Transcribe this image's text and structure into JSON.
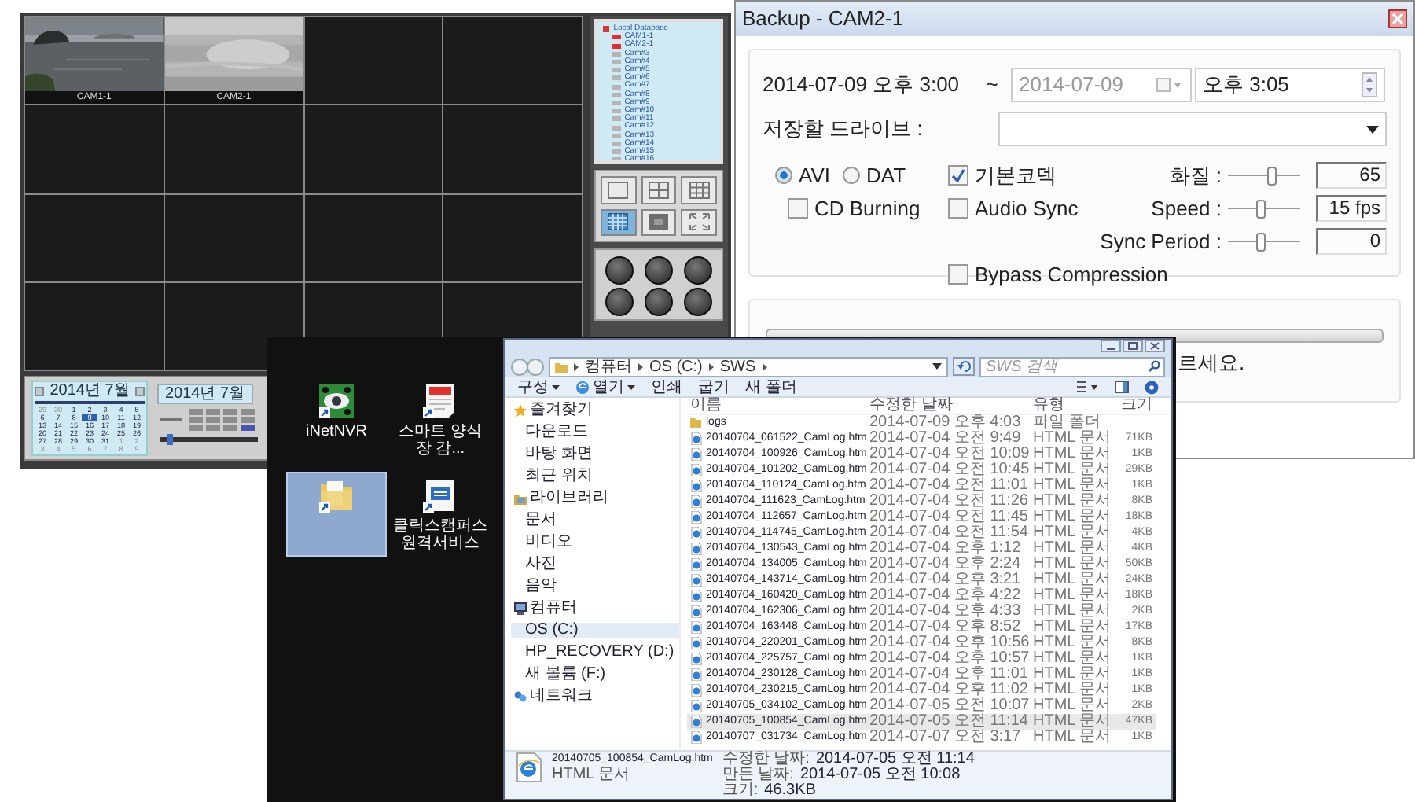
{
  "dvr": {
    "tiles": [
      {
        "kind": "picture",
        "label": "CAM1-1"
      },
      {
        "kind": "picture",
        "label": "CAM2-1"
      },
      {
        "kind": "empty"
      },
      {
        "kind": "empty"
      },
      {
        "kind": "empty"
      },
      {
        "kind": "empty"
      },
      {
        "kind": "empty"
      },
      {
        "kind": "empty"
      },
      {
        "kind": "empty"
      },
      {
        "kind": "empty"
      },
      {
        "kind": "empty"
      },
      {
        "kind": "empty"
      },
      {
        "kind": "empty"
      },
      {
        "kind": "empty"
      },
      {
        "kind": "empty"
      },
      {
        "kind": "empty"
      }
    ],
    "tree": {
      "label": "Local Database",
      "children": [
        {
          "label": "CAM1-1",
          "recording": true
        },
        {
          "label": "CAM2-1",
          "recording": true
        },
        {
          "label": "Cam#3",
          "recording": false
        },
        {
          "label": "Cam#4",
          "recording": false
        },
        {
          "label": "Cam#5",
          "recording": false
        },
        {
          "label": "Cam#6",
          "recording": false
        },
        {
          "label": "Cam#7",
          "recording": false
        },
        {
          "label": "Cam#8",
          "recording": false
        },
        {
          "label": "Cam#9",
          "recording": false
        },
        {
          "label": "Cam#10",
          "recording": false
        },
        {
          "label": "Cam#11",
          "recording": false
        },
        {
          "label": "Cam#12",
          "recording": false
        },
        {
          "label": "Cam#13",
          "recording": false
        },
        {
          "label": "Cam#14",
          "recording": false
        },
        {
          "label": "Cam#15",
          "recording": false
        },
        {
          "label": "Cam#16",
          "recording": false
        }
      ]
    },
    "layouts": [
      {
        "kind": "single",
        "selected": false
      },
      {
        "kind": "quad",
        "selected": false
      },
      {
        "kind": "nine",
        "selected": false
      },
      {
        "kind": "sixteen",
        "selected": true
      },
      {
        "kind": "panel",
        "selected": false
      },
      {
        "kind": "fullscreen",
        "selected": false
      }
    ],
    "calendar": {
      "title": "2014년 7월",
      "days": [
        {
          "day": "29",
          "other_month": true,
          "selected": false
        },
        {
          "day": "30",
          "other_month": true,
          "selected": false
        },
        {
          "day": "1",
          "other_month": false,
          "selected": false
        },
        {
          "day": "2",
          "other_month": false,
          "selected": false
        },
        {
          "day": "3",
          "other_month": false,
          "selected": false
        },
        {
          "day": "4",
          "other_month": false,
          "selected": false
        },
        {
          "day": "5",
          "other_month": false,
          "selected": false
        },
        {
          "day": "6",
          "other_month": false,
          "selected": false
        },
        {
          "day": "7",
          "other_month": false,
          "selected": false
        },
        {
          "day": "8",
          "other_month": false,
          "selected": false
        },
        {
          "day": "9",
          "other_month": false,
          "selected": true
        },
        {
          "day": "10",
          "other_month": false,
          "selected": false
        },
        {
          "day": "11",
          "other_month": false,
          "selected": false
        },
        {
          "day": "12",
          "other_month": false,
          "selected": false
        },
        {
          "day": "13",
          "other_month": false,
          "selected": false
        },
        {
          "day": "14",
          "other_month": false,
          "selected": false
        },
        {
          "day": "15",
          "other_month": false,
          "selected": false
        },
        {
          "day": "16",
          "other_month": false,
          "selected": false
        },
        {
          "day": "17",
          "other_month": false,
          "selected": false
        },
        {
          "day": "18",
          "other_month": false,
          "selected": false
        },
        {
          "day": "19",
          "other_month": false,
          "selected": false
        },
        {
          "day": "20",
          "other_month": false,
          "selected": false
        },
        {
          "day": "21",
          "other_month": false,
          "selected": false
        },
        {
          "day": "22",
          "other_month": false,
          "selected": false
        },
        {
          "day": "23",
          "other_month": false,
          "selected": false
        },
        {
          "day": "24",
          "other_month": false,
          "selected": false
        },
        {
          "day": "25",
          "other_month": false,
          "selected": false
        },
        {
          "day": "26",
          "other_month": false,
          "selected": false
        },
        {
          "day": "27",
          "other_month": false,
          "selected": false
        },
        {
          "day": "28",
          "other_month": false,
          "selected": false
        },
        {
          "day": "29",
          "other_month": false,
          "selected": false
        },
        {
          "day": "30",
          "other_month": false,
          "selected": false
        },
        {
          "day": "31",
          "other_month": false,
          "selected": false
        },
        {
          "day": "1",
          "other_month": true,
          "selected": false
        },
        {
          "day": "2",
          "other_month": true,
          "selected": false
        },
        {
          "day": "3",
          "other_month": true,
          "selected": false
        },
        {
          "day": "4",
          "other_month": true,
          "selected": false
        },
        {
          "day": "5",
          "other_month": true,
          "selected": false
        },
        {
          "day": "6",
          "other_month": true,
          "selected": false
        },
        {
          "day": "7",
          "other_month": true,
          "selected": false
        },
        {
          "day": "8",
          "other_month": true,
          "selected": false
        },
        {
          "day": "9",
          "other_month": true,
          "selected": false
        }
      ]
    },
    "timeline": {
      "title": "2014년 7월"
    }
  },
  "backup": {
    "title": "Backup - CAM2-1",
    "start": "2014-07-09 오후 3:00",
    "separator": "~",
    "end_date": {
      "value": "2014-07-09",
      "disabled": true
    },
    "end_time": "오후 3:05",
    "drive_label": "저장할 드라이브 :",
    "formats": [
      {
        "label": "AVI",
        "selected": true
      },
      {
        "label": "DAT",
        "selected": false
      }
    ],
    "cd_burning": {
      "label": "CD Burning",
      "checked": false
    },
    "options": [
      {
        "label": "기본코덱",
        "checked": true
      },
      {
        "label": "Audio Sync",
        "checked": false
      }
    ],
    "sliders": [
      {
        "label": "화질 :",
        "level": 0.6,
        "value": "65"
      },
      {
        "label": "Speed :",
        "level": 0.45,
        "value": "15 fps"
      },
      {
        "label": "Sync Period :",
        "level": 0.45,
        "value": "0"
      }
    ],
    "bypass": {
      "label": "Bypass Compression",
      "checked": false
    },
    "progress": {
      "level": 0
    },
    "message": "르세요."
  },
  "desktop": {
    "icons": [
      {
        "kind": "eye",
        "label": "iNetNVR",
        "selected": false
      },
      {
        "kind": "document",
        "label": "스마트 양식장 감...",
        "selected": false
      },
      {
        "kind": "folder",
        "selected": true
      },
      {
        "kind": "app",
        "label": "클릭스캠퍼스 원격서비스",
        "selected": false
      }
    ]
  },
  "explorer": {
    "breadcrumb": [
      "컴퓨터",
      "OS (C:)",
      "SWS"
    ],
    "search": {
      "placeholder": "SWS 검색"
    },
    "toolbar": [
      {
        "label": "구성",
        "dropdown": true
      },
      {
        "label": "열기",
        "dropdown": true
      },
      {
        "label": "인쇄",
        "dropdown": false
      },
      {
        "label": "굽기",
        "dropdown": false
      },
      {
        "label": "새 폴더",
        "dropdown": false
      }
    ],
    "sidebar": [
      {
        "kind": "favorites",
        "label": "즐겨찾기",
        "children": [
          {
            "label": "다운로드",
            "selected": false
          },
          {
            "label": "바탕 화면",
            "selected": false
          },
          {
            "label": "최근 위치",
            "selected": false
          }
        ]
      },
      {
        "kind": "libraries",
        "label": "라이브러리",
        "children": [
          {
            "label": "문서",
            "selected": false
          },
          {
            "label": "비디오",
            "selected": false
          },
          {
            "label": "사진",
            "selected": false
          },
          {
            "label": "음악",
            "selected": false
          }
        ]
      },
      {
        "kind": "computer",
        "label": "컴퓨터",
        "children": [
          {
            "label": "OS (C:)",
            "selected": true
          },
          {
            "label": "HP_RECOVERY (D:)",
            "selected": false
          },
          {
            "label": "새 볼륨 (F:)",
            "selected": false
          }
        ]
      },
      {
        "kind": "network",
        "label": "네트워크"
      }
    ],
    "columns": [
      "이름",
      "수정한 날짜",
      "유형",
      "크기"
    ],
    "rows": [
      {
        "kind": "folder",
        "name": "logs",
        "date": "2014-07-09 오후 4:03",
        "type": "파일 폴더",
        "selected": false
      },
      {
        "kind": "html",
        "name": "20140704_061522_CamLog.htm",
        "date": "2014-07-04 오전 9:49",
        "type": "HTML 문서",
        "size": "71KB",
        "selected": false
      },
      {
        "kind": "html",
        "name": "20140704_100926_CamLog.htm",
        "date": "2014-07-04 오전 10:09",
        "type": "HTML 문서",
        "size": "1KB",
        "selected": false
      },
      {
        "kind": "html",
        "name": "20140704_101202_CamLog.htm",
        "date": "2014-07-04 오전 10:45",
        "type": "HTML 문서",
        "size": "29KB",
        "selected": false
      },
      {
        "kind": "html",
        "name": "20140704_110124_CamLog.htm",
        "date": "2014-07-04 오전 11:01",
        "type": "HTML 문서",
        "size": "1KB",
        "selected": false
      },
      {
        "kind": "html",
        "name": "20140704_111623_CamLog.htm",
        "date": "2014-07-04 오전 11:26",
        "type": "HTML 문서",
        "size": "8KB",
        "selected": false
      },
      {
        "kind": "html",
        "name": "20140704_112657_CamLog.htm",
        "date": "2014-07-04 오전 11:45",
        "type": "HTML 문서",
        "size": "18KB",
        "selected": false
      },
      {
        "kind": "html",
        "name": "20140704_114745_CamLog.htm",
        "date": "2014-07-04 오전 11:54",
        "type": "HTML 문서",
        "size": "4KB",
        "selected": false
      },
      {
        "kind": "html",
        "name": "20140704_130543_CamLog.htm",
        "date": "2014-07-04 오후 1:12",
        "type": "HTML 문서",
        "size": "4KB",
        "selected": false
      },
      {
        "kind": "html",
        "name": "20140704_134005_CamLog.htm",
        "date": "2014-07-04 오후 2:24",
        "type": "HTML 문서",
        "size": "50KB",
        "selected": false
      },
      {
        "kind": "html",
        "name": "20140704_143714_CamLog.htm",
        "date": "2014-07-04 오후 3:21",
        "type": "HTML 문서",
        "size": "24KB",
        "selected": false
      },
      {
        "kind": "html",
        "name": "20140704_160420_CamLog.htm",
        "date": "2014-07-04 오후 4:22",
        "type": "HTML 문서",
        "size": "18KB",
        "selected": false
      },
      {
        "kind": "html",
        "name": "20140704_162306_CamLog.htm",
        "date": "2014-07-04 오후 4:33",
        "type": "HTML 문서",
        "size": "2KB",
        "selected": false
      },
      {
        "kind": "html",
        "name": "20140704_163448_CamLog.htm",
        "date": "2014-07-04 오후 8:52",
        "type": "HTML 문서",
        "size": "17KB",
        "selected": false
      },
      {
        "kind": "html",
        "name": "20140704_220201_CamLog.htm",
        "date": "2014-07-04 오후 10:56",
        "type": "HTML 문서",
        "size": "8KB",
        "selected": false
      },
      {
        "kind": "html",
        "name": "20140704_225757_CamLog.htm",
        "date": "2014-07-04 오후 10:57",
        "type": "HTML 문서",
        "size": "1KB",
        "selected": false
      },
      {
        "kind": "html",
        "name": "20140704_230128_CamLog.htm",
        "date": "2014-07-04 오후 11:01",
        "type": "HTML 문서",
        "size": "1KB",
        "selected": false
      },
      {
        "kind": "html",
        "name": "20140704_230215_CamLog.htm",
        "date": "2014-07-04 오후 11:02",
        "type": "HTML 문서",
        "size": "1KB",
        "selected": false
      },
      {
        "kind": "html",
        "name": "20140705_034102_CamLog.htm",
        "date": "2014-07-05 오전 10:07",
        "type": "HTML 문서",
        "size": "2KB",
        "selected": false
      },
      {
        "kind": "html",
        "name": "20140705_100854_CamLog.htm",
        "date": "2014-07-05 오전 11:14",
        "type": "HTML 문서",
        "size": "47KB",
        "selected": true
      },
      {
        "kind": "html",
        "name": "20140707_031734_CamLog.htm",
        "date": "2014-07-07 오전 3:17",
        "type": "HTML 문서",
        "size": "1KB",
        "selected": false
      }
    ],
    "status": {
      "name": "20140705_100854_CamLog.htm",
      "type": "HTML 문서",
      "modified_label": "수정한 날짜:",
      "modified": "2014-07-05 오전 11:14",
      "created_label": "만든 날짜:",
      "created": "2014-07-05 오전 10:08",
      "size_label": "크기:",
      "size": "46.3KB"
    }
  }
}
